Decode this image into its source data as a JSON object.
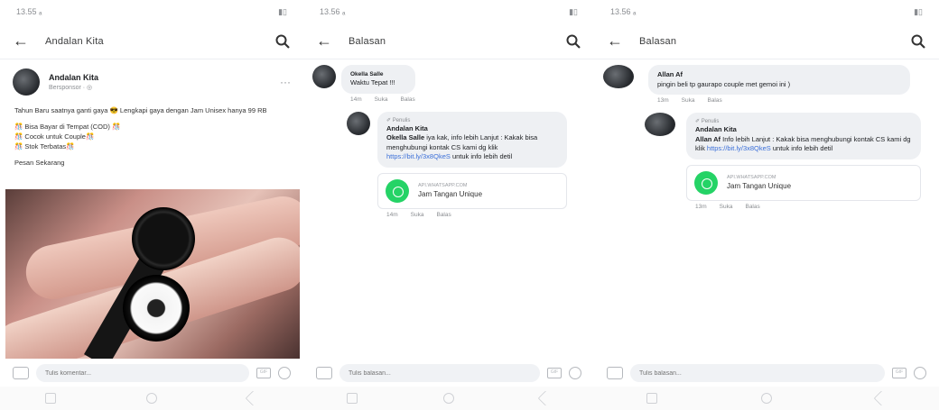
{
  "s1": {
    "status_time": "13.55 ₐ",
    "status_right": "",
    "title": "Andalan Kita",
    "post": {
      "author": "Andalan Kita",
      "time": "Bersponsor · ◎",
      "more": "···",
      "lines": [
        "Tahun Baru saatnya ganti gaya 😎 Lengkapi gaya dengan Jam Unisex hanya 99 RB",
        "🎊 Bisa Bayar di Tempat (COD) 🎊\n🎊 Cocok untuk Couple🎊\n🎊 Stok Terbatas🎊",
        "Pesan Sekarang"
      ]
    },
    "composer_placeholder": "Tulis komentar..."
  },
  "s2": {
    "status_time": "13.56 ₐ",
    "title": "Balasan",
    "comment1": {
      "name": "Okella Salle",
      "text": "Waktu Tepat !!!",
      "actions": [
        "14m",
        "Suka",
        "Balas"
      ]
    },
    "reply": {
      "author_tag": "✐ Penulis",
      "name": "Andalan Kita",
      "mention": "Okella Salle",
      "text": " iya kak, info lebih Lanjut : Kakak bisa menghubungi kontak CS kami dg klik ",
      "link": "https://bit.ly/3x8QkeS",
      "text2": " untuk info lebih detil",
      "card_domain": "API.WHATSAPP.COM",
      "card_title": "Jam Tangan Unique",
      "actions": [
        "14m",
        "Suka",
        "Balas"
      ]
    },
    "composer_placeholder": "Tulis balasan..."
  },
  "s3": {
    "status_time": "13.56 ₐ",
    "title": "Balasan",
    "comment1": {
      "name": "Allan Af",
      "text": "pingin beli tp gaurapo couple met gemoi ini )",
      "actions": [
        "13m",
        "Suka",
        "Balas"
      ]
    },
    "reply": {
      "author_tag": "✐ Penulis",
      "name": "Andalan Kita",
      "mention": "Allan Af",
      "text": " Info lebih Lanjut : Kakak bisa menghubungi kontak CS kami dg klik ",
      "link": "https://bit.ly/3x8QkeS",
      "text2": " untuk info lebih detil",
      "card_domain": "API.WHATSAPP.COM",
      "card_title": "Jam Tangan Unique",
      "actions": [
        "13m",
        "Suka",
        "Balas"
      ]
    },
    "composer_placeholder": "Tulis balasan..."
  }
}
